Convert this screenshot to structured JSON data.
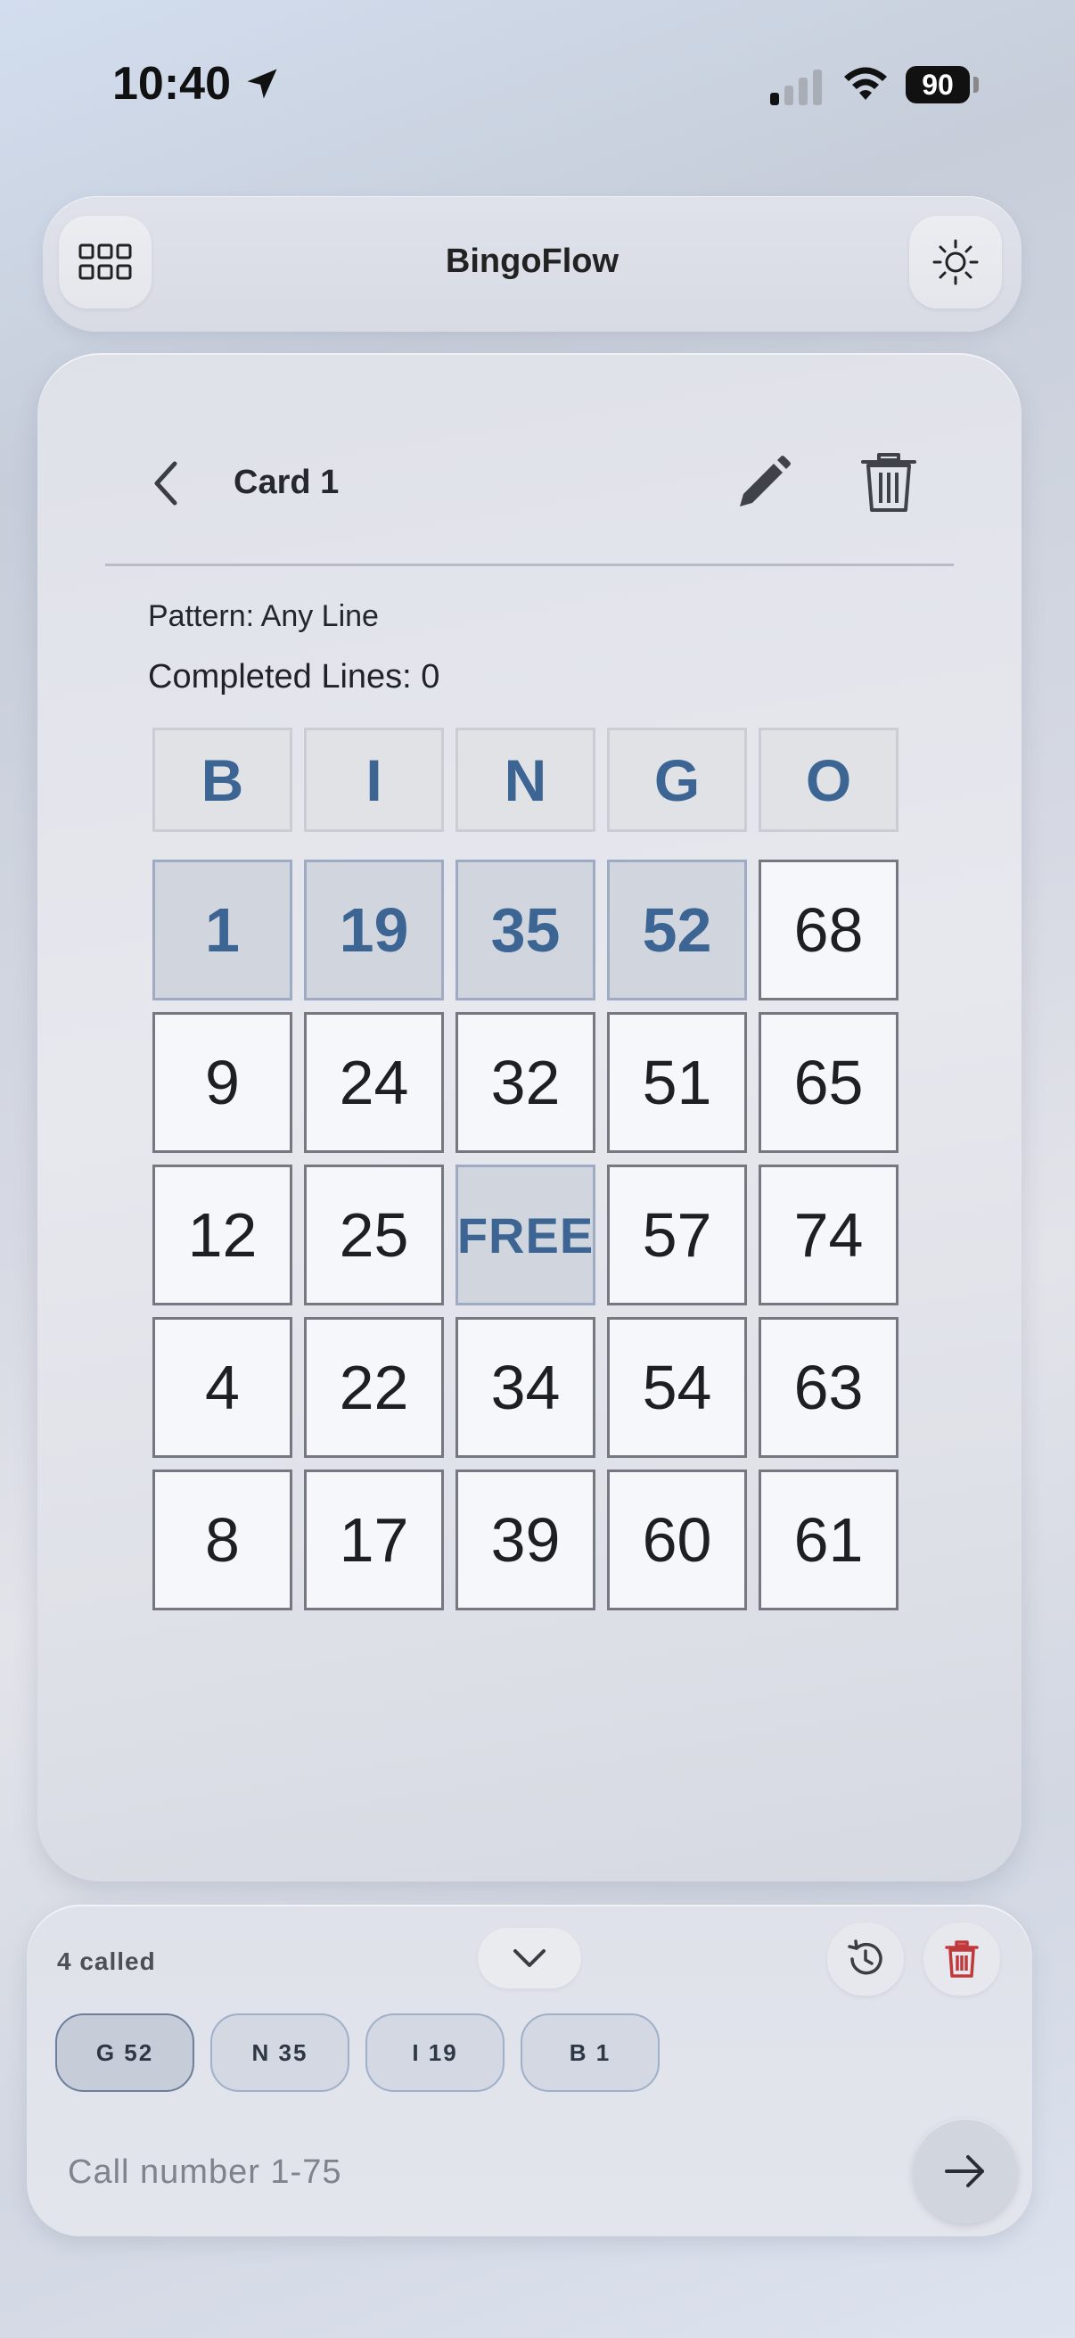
{
  "status_bar": {
    "time": "10:40",
    "battery": "90"
  },
  "header": {
    "title": "BingoFlow",
    "menu_icon": "grid-menu-icon",
    "theme_icon": "sun-icon"
  },
  "card": {
    "title": "Card 1",
    "pattern": "Pattern: Any Line",
    "completed_lines": "Completed Lines: 0",
    "columns": [
      "B",
      "I",
      "N",
      "G",
      "O"
    ],
    "rows": [
      [
        {
          "v": "1",
          "marked": true
        },
        {
          "v": "19",
          "marked": true
        },
        {
          "v": "35",
          "marked": true
        },
        {
          "v": "52",
          "marked": true
        },
        {
          "v": "68",
          "marked": false
        }
      ],
      [
        {
          "v": "9",
          "marked": false
        },
        {
          "v": "24",
          "marked": false
        },
        {
          "v": "32",
          "marked": false
        },
        {
          "v": "51",
          "marked": false
        },
        {
          "v": "65",
          "marked": false
        }
      ],
      [
        {
          "v": "12",
          "marked": false
        },
        {
          "v": "25",
          "marked": false
        },
        {
          "v": "FREE",
          "marked": true
        },
        {
          "v": "57",
          "marked": false
        },
        {
          "v": "74",
          "marked": false
        }
      ],
      [
        {
          "v": "4",
          "marked": false
        },
        {
          "v": "22",
          "marked": false
        },
        {
          "v": "34",
          "marked": false
        },
        {
          "v": "54",
          "marked": false
        },
        {
          "v": "63",
          "marked": false
        }
      ],
      [
        {
          "v": "8",
          "marked": false
        },
        {
          "v": "17",
          "marked": false
        },
        {
          "v": "39",
          "marked": false
        },
        {
          "v": "60",
          "marked": false
        },
        {
          "v": "61",
          "marked": false
        }
      ]
    ]
  },
  "called": {
    "count_label": "4 called",
    "numbers": [
      "G 52",
      "N 35",
      "I 19",
      "B 1"
    ]
  },
  "input": {
    "placeholder": "Call number 1-75"
  },
  "colors": {
    "marked_text": "#3c6593",
    "delete_accent": "#c0393b"
  }
}
